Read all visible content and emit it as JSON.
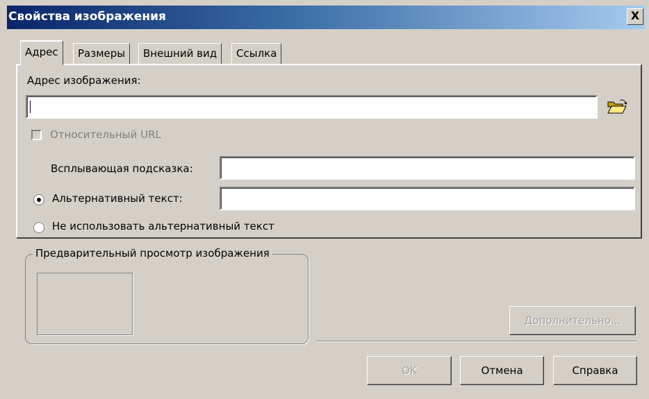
{
  "window": {
    "title": "Свойства изображения",
    "close_label": "X"
  },
  "tabs": [
    {
      "label": "Адрес",
      "active": true
    },
    {
      "label": "Размеры",
      "active": false
    },
    {
      "label": "Внешний вид",
      "active": false
    },
    {
      "label": "Ссылка",
      "active": false
    }
  ],
  "address": {
    "label": "Адрес изображения:",
    "value": "",
    "browse_icon": "open-folder-icon"
  },
  "relative_url": {
    "label": "Относительный URL",
    "checked": false,
    "enabled": false
  },
  "tooltip": {
    "label": "Всплывающая подсказка:",
    "value": ""
  },
  "alt_text_option": {
    "label": "Альтернативный текст:",
    "selected": true,
    "value": ""
  },
  "no_alt_option": {
    "label": "Не использовать альтернативный текст",
    "selected": false
  },
  "preview": {
    "title": "Предварительный просмотр изображения"
  },
  "buttons": {
    "advanced": "Дополнительно...",
    "ok": "OK",
    "cancel": "Отмена",
    "help": "Справка"
  },
  "colors": {
    "titlebar_start": "#0a246a",
    "titlebar_end": "#a6caf0",
    "face": "#d4d0c8"
  }
}
